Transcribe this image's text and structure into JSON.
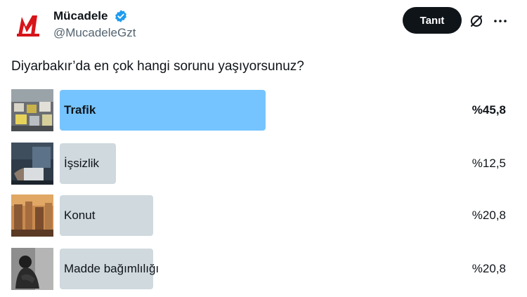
{
  "account": {
    "display_name": "Mücadele",
    "handle": "@MucadeleGzt",
    "verified": true,
    "avatar_icon": "mucadele-logo-icon",
    "follow_label": "Tanıt"
  },
  "post": {
    "question": "Diyarbakır’da en çok hangi sorunu yaşıyorsunuz?"
  },
  "poll": {
    "options": [
      {
        "label": "Trafik",
        "percent": "%45,8",
        "share": 45.8,
        "winner": true,
        "image": "traffic-photo"
      },
      {
        "label": "İşsizlik",
        "percent": "%12,5",
        "share": 12.5,
        "winner": false,
        "image": "unemployment-photo"
      },
      {
        "label": "Konut",
        "percent": "%20,8",
        "share": 20.8,
        "winner": false,
        "image": "housing-photo"
      },
      {
        "label": "Madde bağımlılığı",
        "percent": "%20,8",
        "share": 20.8,
        "winner": false,
        "image": "addiction-photo"
      }
    ]
  },
  "colors": {
    "winner_bar": "#75c4ff",
    "bar": "#cfd9de",
    "verified": "#1d9bf0",
    "follow_bg": "#0f1419"
  }
}
